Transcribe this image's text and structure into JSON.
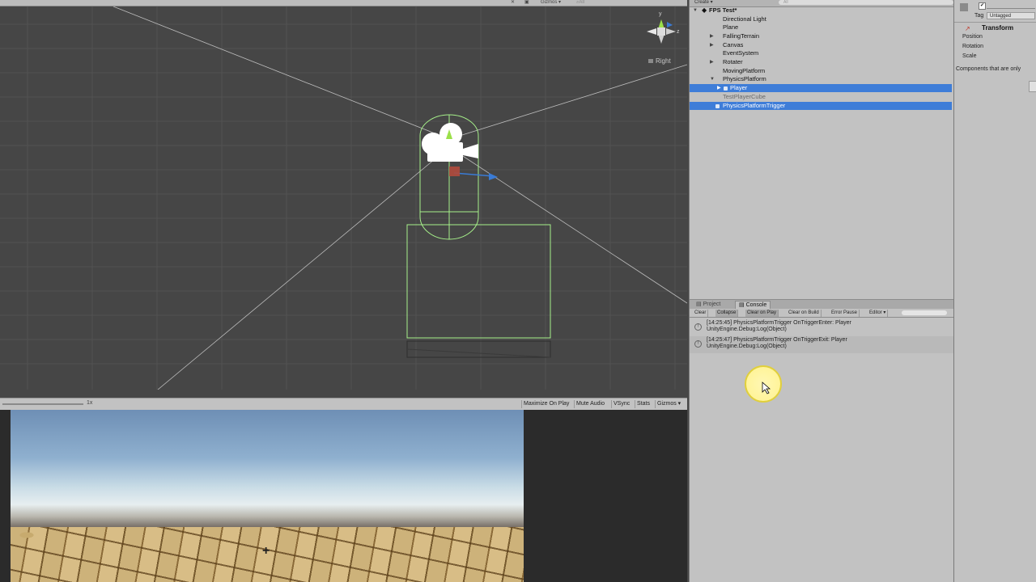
{
  "scene": {
    "toolbar": {
      "gizmos": "Gizmos ▾",
      "search": "All"
    },
    "gizmo": {
      "y_label": "y",
      "z_label": "z",
      "persp_label": "Right"
    }
  },
  "game": {
    "scale_label": "1x",
    "buttons": [
      "Maximize On Play",
      "Mute Audio",
      "VSync",
      "Stats",
      "Gizmos ▾"
    ]
  },
  "hierarchy": {
    "create_label": "Create ▾",
    "search_placeholder": "All",
    "scene_name": "FPS Test*",
    "items": [
      {
        "label": "Directional Light"
      },
      {
        "label": "Plane"
      },
      {
        "label": "FallingTerrain"
      },
      {
        "label": "Canvas"
      },
      {
        "label": "EventSystem"
      },
      {
        "label": "Rotater"
      },
      {
        "label": "MovingPlatform"
      },
      {
        "label": "PhysicsPlatform"
      },
      {
        "label": "Player"
      },
      {
        "label": "TestPlayerCube"
      },
      {
        "label": "PhysicsPlatformTrigger"
      }
    ]
  },
  "console": {
    "tabs": {
      "project": "Project",
      "console": "Console"
    },
    "toolbar": [
      "Clear",
      "Collapse",
      "Clear on Play",
      "Clear on Build",
      "Error Pause",
      "Editor ▾"
    ],
    "logs": [
      {
        "line1": "[14:25:45] PhysicsPlatformTrigger OnTriggerEnter: Player",
        "line2": "UnityEngine.Debug:Log(Object)"
      },
      {
        "line1": "[14:25:47] PhysicsPlatformTrigger OnTriggerExit: Player",
        "line2": "UnityEngine.Debug:Log(Object)"
      }
    ]
  },
  "inspector": {
    "tag_label": "Tag",
    "tag_value": "Untagged",
    "component_title": "Transform",
    "rows": [
      "Position",
      "Rotation",
      "Scale"
    ],
    "note": "Components that are only"
  },
  "colors": {
    "selection": "#3e7dd8",
    "panel_bg": "#c2c2c2",
    "scene_bg": "#464646",
    "collider_green": "#a6f08a"
  }
}
